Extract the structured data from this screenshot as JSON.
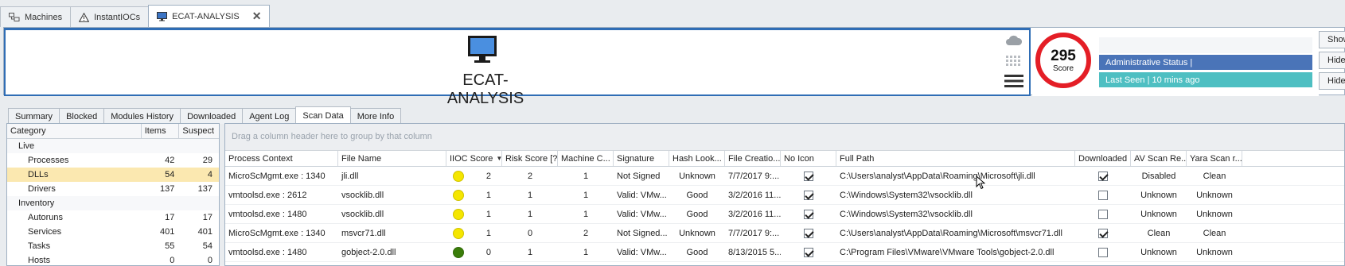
{
  "doc_tabs": [
    {
      "label": "Machines",
      "icon": "machines-icon"
    },
    {
      "label": "InstantIOCs",
      "icon": "warning-icon"
    },
    {
      "label": "ECAT-ANALYSIS",
      "icon": "monitor-icon",
      "active": true
    }
  ],
  "header": {
    "machine_name": "ECAT-ANALYSIS",
    "score_value": "295",
    "score_label": "Score",
    "admin_status": "Administrative Status  |",
    "last_seen": "Last Seen | 10 mins ago",
    "side_icons": [
      "cloud-icon",
      "grid-icon",
      "hamburger-menu-icon"
    ],
    "right_buttons": [
      "Show",
      "Hide",
      "Hide V"
    ]
  },
  "section_tabs": [
    {
      "label": "Summary"
    },
    {
      "label": "Blocked"
    },
    {
      "label": "Modules History"
    },
    {
      "label": "Downloaded"
    },
    {
      "label": "Agent Log"
    },
    {
      "label": "Scan Data",
      "active": true
    },
    {
      "label": "More Info"
    }
  ],
  "category_panel": {
    "headers": {
      "category": "Category",
      "items": "Items",
      "suspect": "Suspect"
    },
    "groups": [
      {
        "label": "Live",
        "rows": [
          {
            "name": "Processes",
            "items": "42",
            "suspect": "29"
          },
          {
            "name": "DLLs",
            "items": "54",
            "suspect": "4",
            "selected": true
          },
          {
            "name": "Drivers",
            "items": "137",
            "suspect": "137"
          }
        ]
      },
      {
        "label": "Inventory",
        "rows": [
          {
            "name": "Autoruns",
            "items": "17",
            "suspect": "17"
          },
          {
            "name": "Services",
            "items": "401",
            "suspect": "401"
          },
          {
            "name": "Tasks",
            "items": "55",
            "suspect": "54"
          },
          {
            "name": "Hosts",
            "items": "0",
            "suspect": "0"
          }
        ]
      }
    ]
  },
  "grid": {
    "group_hint": "Drag a column header here to group by that column",
    "columns": {
      "process_context": "Process Context",
      "file_name": "File Name",
      "iioc_score": "IIOC Score",
      "risk_score": "Risk Score [?]",
      "machine_count": "Machine C...",
      "signature": "Signature",
      "hash_lookup": "Hash Look...",
      "file_creation": "File Creatio...",
      "no_icon": "No Icon",
      "full_path": "Full Path",
      "downloaded": "Downloaded",
      "av_scan": "AV Scan Re...",
      "yara_scan": "Yara Scan r..."
    },
    "rows": [
      {
        "process_context": "MicroScMgmt.exe : 1340",
        "file_name": "jli.dll",
        "dot_color": "#f5e600",
        "iioc": "2",
        "risk": "2",
        "machines": "1",
        "signature": "Not Signed",
        "hash": "Unknown",
        "created": "7/7/2017 9:...",
        "no_icon": true,
        "path": "C:\\Users\\analyst\\AppData\\Roaming\\Microsoft\\jli.dll",
        "downloaded": true,
        "av": "Disabled",
        "yara": "Clean"
      },
      {
        "process_context": "vmtoolsd.exe : 2612",
        "file_name": "vsocklib.dll",
        "dot_color": "#f5e600",
        "iioc": "1",
        "risk": "1",
        "machines": "1",
        "signature": "Valid: VMw...",
        "hash": "Good",
        "created": "3/2/2016 11...",
        "no_icon": true,
        "path": "C:\\Windows\\System32\\vsocklib.dll",
        "downloaded": false,
        "av": "Unknown",
        "yara": "Unknown"
      },
      {
        "process_context": "vmtoolsd.exe : 1480",
        "file_name": "vsocklib.dll",
        "dot_color": "#f5e600",
        "iioc": "1",
        "risk": "1",
        "machines": "1",
        "signature": "Valid: VMw...",
        "hash": "Good",
        "created": "3/2/2016 11...",
        "no_icon": true,
        "path": "C:\\Windows\\System32\\vsocklib.dll",
        "downloaded": false,
        "av": "Unknown",
        "yara": "Unknown"
      },
      {
        "process_context": "MicroScMgmt.exe : 1340",
        "file_name": "msvcr71.dll",
        "dot_color": "#f5e600",
        "iioc": "1",
        "risk": "0",
        "machines": "2",
        "signature": "Not Signed...",
        "hash": "Unknown",
        "created": "7/7/2017 9:...",
        "no_icon": true,
        "path": "C:\\Users\\analyst\\AppData\\Roaming\\Microsoft\\msvcr71.dll",
        "downloaded": true,
        "av": "Clean",
        "yara": "Clean"
      },
      {
        "process_context": "vmtoolsd.exe : 1480",
        "file_name": "gobject-2.0.dll",
        "dot_color": "#3a7d0a",
        "iioc": "0",
        "risk": "1",
        "machines": "1",
        "signature": "Valid: VMw...",
        "hash": "Good",
        "created": "8/13/2015 5...",
        "no_icon": true,
        "path": "C:\\Program Files\\VMware\\VMware Tools\\gobject-2.0.dll",
        "downloaded": false,
        "av": "Unknown",
        "yara": "Unknown"
      }
    ]
  },
  "colors": {
    "score_ring": "#e41e26",
    "admin_bar": "#4a74b8",
    "seen_bar": "#4ebfc2",
    "selected_row": "#fbe8b0",
    "accent_border": "#2f6db5"
  }
}
